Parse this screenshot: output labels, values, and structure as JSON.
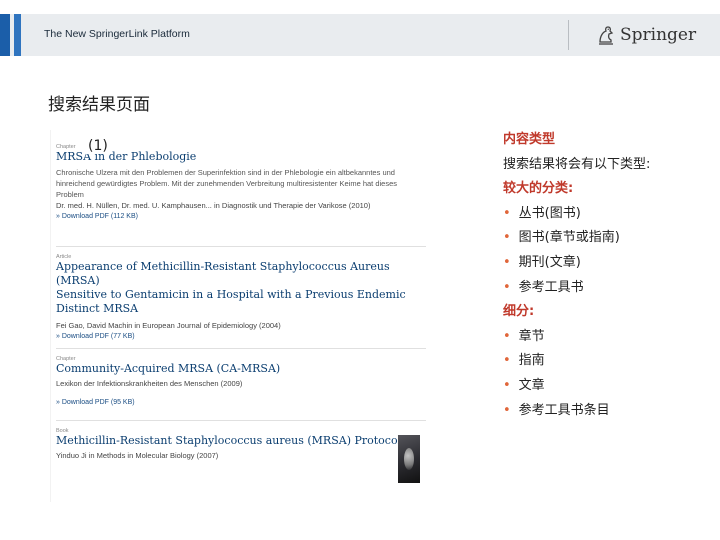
{
  "header": {
    "title": "The New SpringerLink Platform",
    "brand": "Springer",
    "brand_icon": "springer-horse-icon"
  },
  "page_title": "搜索结果页面",
  "label_number": "(1)",
  "results": [
    {
      "type": "Chapter",
      "title": "MRSA in der Phlebologie",
      "desc": [
        "Chronische Ulzera mit den Problemen der Superinfektion sind in der Phlebologie ein altbekanntes und",
        "hinreichend gewürdigtes Problem. Mit der zunehmenden Verbreitung multiresistenter Keime hat dieses",
        "Problem"
      ],
      "meta": "Dr. med. H. Nüllen, Dr. med. U. Kamphausen... in Diagnostik und Therapie der Varikose (2010)",
      "download": "» Download PDF (112 KB)"
    },
    {
      "type": "Article",
      "title_lines": [
        "Appearance of Methicillin-Resistant Staphylococcus Aureus (MRSA)",
        "Sensitive to Gentamicin in a Hospital with a Previous Endemic",
        "Distinct MRSA"
      ],
      "meta": "Fei Gao, David Machin in European Journal of Epidemiology (2004)",
      "download": "» Download PDF (77 KB)"
    },
    {
      "type": "Chapter",
      "title": "Community-Acquired MRSA (CA-MRSA)",
      "meta": "Lexikon der Infektionskrankheiten des Menschen (2009)",
      "download": "» Download PDF (95 KB)"
    },
    {
      "type": "Book",
      "title": "Methicillin-Resistant Staphylococcus aureus (MRSA) Protocols",
      "meta": "Yinduo Ji in Methods in Molecular Biology (2007)"
    }
  ],
  "content_types": {
    "heading": "内容类型",
    "intro": "搜索结果将会有以下类型:",
    "broad_heading": "较大的分类:",
    "broad_items": [
      "丛书(图书)",
      "图书(章节或指南)",
      "期刊(文章)",
      "参考工具书"
    ],
    "fine_heading": "细分:",
    "fine_items": [
      "章节",
      "指南",
      "文章",
      "参考工具书条目"
    ]
  },
  "colors": {
    "accent_blue": "#1b5ea9",
    "title_blue": "#0b3e70",
    "heading_red": "#c0392b",
    "bullet_orange": "#e0663a"
  }
}
